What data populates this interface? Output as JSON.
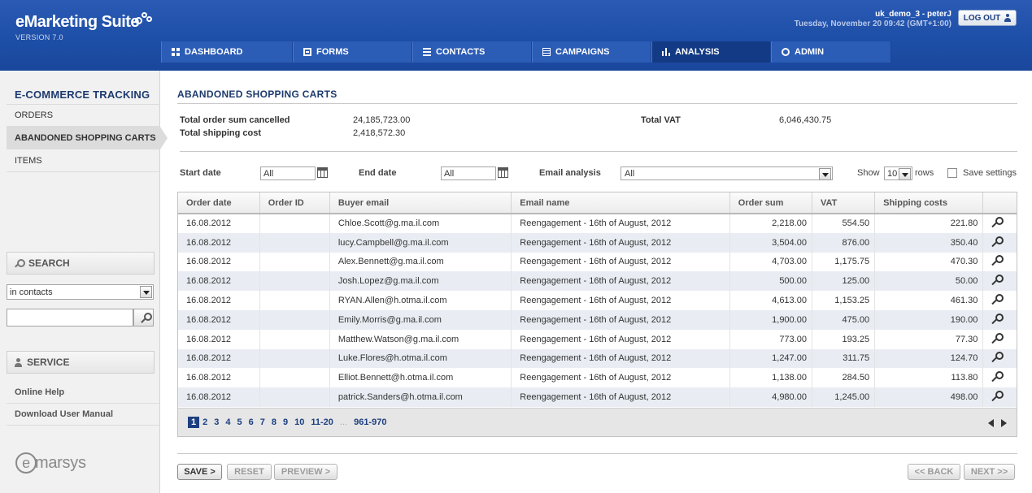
{
  "app": {
    "name": "eMarketing Suite",
    "version": "VERSION 7.0"
  },
  "user": {
    "name": "uk_demo_3 - peterJ",
    "datetime": "Tuesday, November 20 09:42 (GMT+1:00)",
    "logout_label": "LOG OUT"
  },
  "nav": [
    {
      "label": "DASHBOARD",
      "icon": "grid-icon"
    },
    {
      "label": "FORMS",
      "icon": "form-icon"
    },
    {
      "label": "CONTACTS",
      "icon": "list-icon"
    },
    {
      "label": "CAMPAIGNS",
      "icon": "document-icon"
    },
    {
      "label": "ANALYSIS",
      "icon": "bar-chart-icon",
      "active": true
    },
    {
      "label": "ADMIN",
      "icon": "gear-icon"
    }
  ],
  "sidebar": {
    "section_title": "E-COMMERCE TRACKING",
    "items": [
      {
        "label": "ORDERS"
      },
      {
        "label": "ABANDONED SHOPPING CARTS",
        "active": true
      },
      {
        "label": "ITEMS"
      }
    ],
    "search": {
      "title": "SEARCH",
      "scope": "in contacts",
      "query": ""
    },
    "service": {
      "title": "SERVICE",
      "links": [
        "Online Help",
        "Download User Manual"
      ]
    },
    "brand": "marsys"
  },
  "page": {
    "title": "ABANDONED SHOPPING CARTS",
    "summary": {
      "total_order_sum_cancelled_label": "Total order sum cancelled",
      "total_order_sum_cancelled": "24,185,723.00",
      "total_shipping_cost_label": "Total shipping cost",
      "total_shipping_cost": "2,418,572.30",
      "total_vat_label": "Total VAT",
      "total_vat": "6,046,430.75"
    },
    "filters": {
      "start_date_label": "Start date",
      "start_date": "All",
      "end_date_label": "End date",
      "end_date": "All",
      "email_analysis_label": "Email analysis",
      "email_analysis": "All",
      "show_label": "Show",
      "rows_value": "10",
      "rows_label": "rows",
      "save_settings_label": "Save settings"
    },
    "table": {
      "columns": [
        "Order date",
        "Order ID",
        "Buyer email",
        "Email name",
        "Order sum",
        "VAT",
        "Shipping costs"
      ],
      "rows": [
        [
          "16.08.2012",
          "",
          "Chloe.Scott@g.ma.il.com",
          "Reengagement - 16th of August, 2012",
          "2,218.00",
          "554.50",
          "221.80"
        ],
        [
          "16.08.2012",
          "",
          "lucy.Campbell@g.ma.il.com",
          "Reengagement - 16th of August, 2012",
          "3,504.00",
          "876.00",
          "350.40"
        ],
        [
          "16.08.2012",
          "",
          "Alex.Bennett@g.ma.il.com",
          "Reengagement - 16th of August, 2012",
          "4,703.00",
          "1,175.75",
          "470.30"
        ],
        [
          "16.08.2012",
          "",
          "Josh.Lopez@g.ma.il.com",
          "Reengagement - 16th of August, 2012",
          "500.00",
          "125.00",
          "50.00"
        ],
        [
          "16.08.2012",
          "",
          "RYAN.Allen@h.otma.il.com",
          "Reengagement - 16th of August, 2012",
          "4,613.00",
          "1,153.25",
          "461.30"
        ],
        [
          "16.08.2012",
          "",
          "Emily.Morris@g.ma.il.com",
          "Reengagement - 16th of August, 2012",
          "1,900.00",
          "475.00",
          "190.00"
        ],
        [
          "16.08.2012",
          "",
          "Matthew.Watson@g.ma.il.com",
          "Reengagement - 16th of August, 2012",
          "773.00",
          "193.25",
          "77.30"
        ],
        [
          "16.08.2012",
          "",
          "Luke.Flores@h.otma.il.com",
          "Reengagement - 16th of August, 2012",
          "1,247.00",
          "311.75",
          "124.70"
        ],
        [
          "16.08.2012",
          "",
          "Elliot.Bennett@h.otma.il.com",
          "Reengagement - 16th of August, 2012",
          "1,138.00",
          "284.50",
          "113.80"
        ],
        [
          "16.08.2012",
          "",
          "patrick.Sanders@h.otma.il.com",
          "Reengagement - 16th of August, 2012",
          "4,980.00",
          "1,245.00",
          "498.00"
        ]
      ]
    },
    "pagination": {
      "current": "1",
      "pages": [
        "2",
        "3",
        "4",
        "5",
        "6",
        "7",
        "8",
        "9",
        "10",
        "11-20"
      ],
      "ellipsis": "...",
      "last": "961-970"
    },
    "buttons": {
      "save": "SAVE >",
      "reset": "RESET",
      "preview": "PREVIEW >",
      "back": "<< BACK",
      "next": "NEXT >>"
    }
  }
}
